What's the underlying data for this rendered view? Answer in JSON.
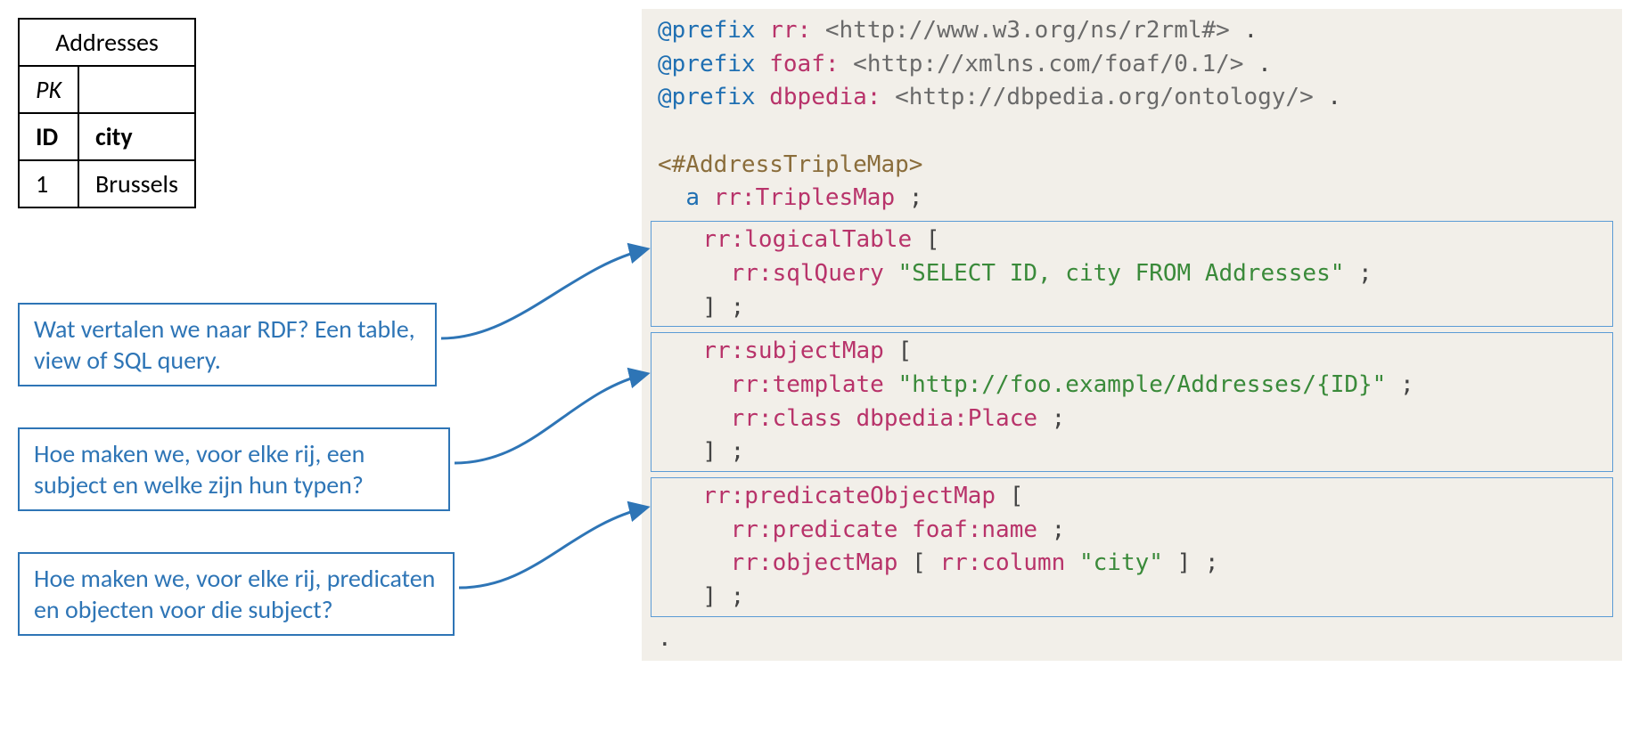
{
  "table": {
    "title": "Addresses",
    "pk_label": "PK",
    "col1": "ID",
    "col2": "city",
    "row_id": "1",
    "row_city": "Brussels"
  },
  "callouts": {
    "c1": "Wat vertalen we naar RDF? Een table, view of SQL query.",
    "c2": "Hoe maken we, voor elke rij, een subject en welke zijn hun typen?",
    "c3": "Hoe maken we, voor elke rij, predicaten en objecten voor die subject?"
  },
  "code": {
    "prefix_kw": "@prefix",
    "rr_pref": "rr:",
    "rr_uri": "<http://www.w3.org/ns/r2rml#>",
    "foaf_pref": "foaf:",
    "foaf_uri": "<http://xmlns.com/foaf/0.1/>",
    "dbp_pref": "dbpedia:",
    "dbp_uri": "<http://dbpedia.org/ontology/>",
    "map_id": "<#AddressTripleMap>",
    "a_kw": "a",
    "triplesmap": "rr:TriplesMap",
    "logicalTable": "rr:logicalTable",
    "sqlQuery": "rr:sqlQuery",
    "sql_str": "\"SELECT ID, city FROM Addresses\"",
    "subjectMap": "rr:subjectMap",
    "template": "rr:template",
    "template_str": "\"http://foo.example/Addresses/{ID}\"",
    "class_kw": "rr:class",
    "place": "dbpedia:Place",
    "pom": "rr:predicateObjectMap",
    "predicate": "rr:predicate",
    "foaf_name": "foaf:name",
    "objectMap": "rr:objectMap",
    "column": "rr:column",
    "city_str": "\"city\"",
    "dot": ".",
    "semi": ";",
    "lbr": "[",
    "rbr": "]"
  }
}
